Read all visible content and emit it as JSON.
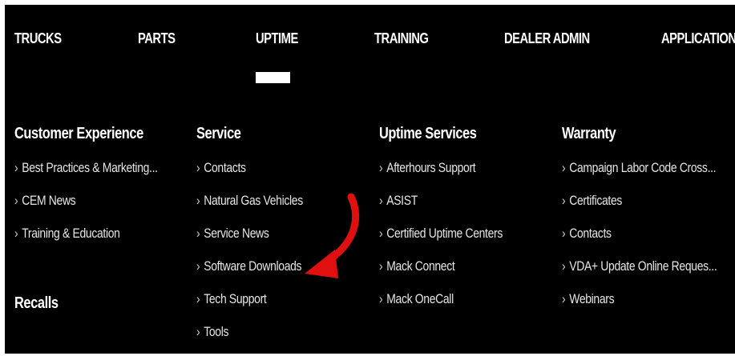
{
  "nav": {
    "items": [
      {
        "label": "TRUCKS"
      },
      {
        "label": "PARTS"
      },
      {
        "label": "UPTIME",
        "active": true
      },
      {
        "label": "TRAINING"
      },
      {
        "label": "DEALER ADMIN"
      },
      {
        "label": "APPLICATIONS"
      }
    ]
  },
  "menu": {
    "columns": [
      {
        "heading": "Customer Experience",
        "links": [
          "Best Practices & Marketing...",
          "CEM News",
          "Training & Education"
        ]
      },
      {
        "heading": "Service",
        "links": [
          "Contacts",
          "Natural Gas Vehicles",
          "Service News",
          "Software Downloads",
          "Tech Support",
          "Tools"
        ]
      },
      {
        "heading": "Uptime Services",
        "links": [
          "Afterhours Support",
          "ASIST",
          "Certified Uptime Centers",
          "Mack Connect",
          "Mack OneCall"
        ]
      },
      {
        "heading": "Warranty",
        "links": [
          "Campaign Labor Code Cross...",
          "Certificates",
          "Contacts",
          "VDA+ Update Online Reques...",
          "Webinars"
        ]
      }
    ],
    "recalls_heading": "Recalls"
  },
  "colors": {
    "background": "#000000",
    "text": "#ffffff",
    "annotation_arrow": "#e01010"
  },
  "icons": {
    "chevron": "chevron-right-icon",
    "annotation": "red-curved-arrow-icon"
  }
}
